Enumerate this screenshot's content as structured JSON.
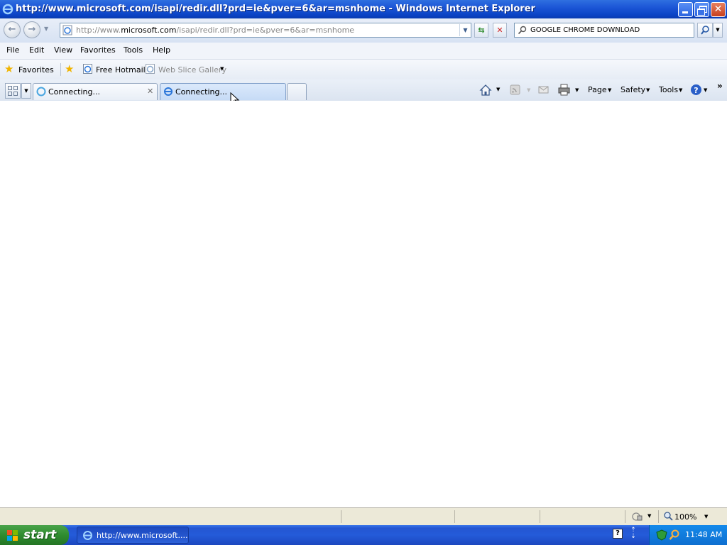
{
  "window": {
    "title": "http://www.microsoft.com/isapi/redir.dll?prd=ie&pver=6&ar=msnhome - Windows Internet Explorer"
  },
  "address_bar": {
    "url_prefix": "http://www.",
    "url_domain": "microsoft.com",
    "url_rest": "/isapi/redir.dll?prd=ie&pver=6&ar=msnhome"
  },
  "search_box": {
    "value": "GOOGLE CHROME DOWNLOAD"
  },
  "menu": {
    "items": [
      "File",
      "Edit",
      "View",
      "Favorites",
      "Tools",
      "Help"
    ]
  },
  "favorites_bar": {
    "favorites_label": "Favorites",
    "links": [
      "Free Hotmail",
      "Web Slice Gallery"
    ]
  },
  "tabs": [
    {
      "label": "Connecting..."
    },
    {
      "label": "Connecting..."
    }
  ],
  "command_bar": {
    "page": "Page",
    "safety": "Safety",
    "tools": "Tools"
  },
  "status_bar": {
    "zoom": "100%"
  },
  "taskbar": {
    "start_label": "start",
    "task_label": "http://www.microsoft....",
    "clock": "11:48 AM"
  },
  "colors": {
    "titlebar": "#0b44c6",
    "start_button": "#2f8c2f",
    "taskbar": "#245bd9"
  }
}
